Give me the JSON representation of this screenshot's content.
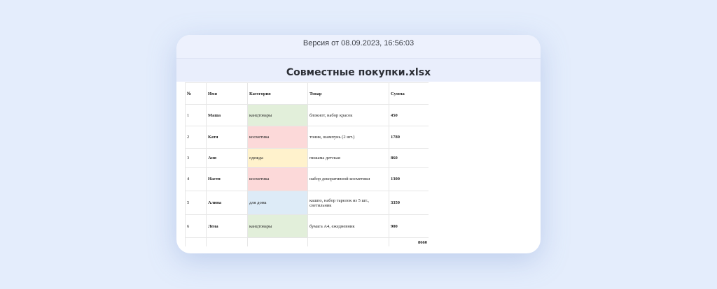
{
  "version_label": "Версия от 08.09.2023, 16:56:03",
  "file_title": "Совместные покупки.xlsx",
  "table": {
    "headers": [
      "№",
      "Имя",
      "Категория",
      "Товар",
      "Сумма"
    ],
    "rows": [
      {
        "no": "1",
        "name": "Маша",
        "category": "канцтовары",
        "color": "#e2efda",
        "item": "блокнот, набор красок",
        "sum": "450",
        "h": 31
      },
      {
        "no": "2",
        "name": "Катя",
        "category": "косметика",
        "color": "#fcd9d9",
        "item": "тоник, шампунь (2 шт.)",
        "sum": "1780",
        "h": 32
      },
      {
        "no": "3",
        "name": "Аня",
        "category": "одежда",
        "color": "#fff2cc",
        "item": "пижама детская",
        "sum": "860",
        "h": 27
      },
      {
        "no": "4",
        "name": "Настя",
        "category": "косметика",
        "color": "#fcd9d9",
        "item": "набор декоративной косметики",
        "sum": "1300",
        "h": 34
      },
      {
        "no": "5",
        "name": "Алина",
        "category": "для дома",
        "color": "#ddebf7",
        "item": "кашпо, набор тарелок из 5 шт., светильник",
        "sum": "3350",
        "h": 34
      },
      {
        "no": "6",
        "name": "Лена",
        "category": "канцтовары",
        "color": "#e2efda",
        "item": "бумага А4, ежедневник",
        "sum": "900",
        "h": 33
      }
    ],
    "total": "8660"
  }
}
